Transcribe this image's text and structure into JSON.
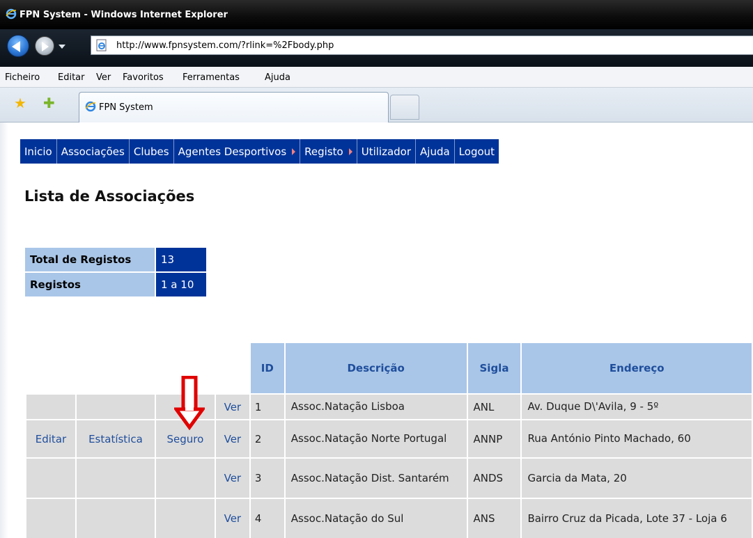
{
  "window": {
    "title": "FPN System - Windows Internet Explorer"
  },
  "address": {
    "url": "http://www.fpnsystem.com/?rlink=%2Fbody.php"
  },
  "menu": [
    "Ficheiro",
    "Editar",
    "Ver",
    "Favoritos",
    "Ferramentas",
    "Ajuda"
  ],
  "tab": {
    "label": "FPN System"
  },
  "nav": {
    "inicio": "Inicio",
    "associacoes": "Associações",
    "clubes": "Clubes",
    "agentes": "Agentes Desportivos",
    "registo": "Registo",
    "utilizador": "Utilizador",
    "ajuda": "Ajuda",
    "logout": "Logout"
  },
  "page": {
    "heading": "Lista de Associações"
  },
  "summary": {
    "total_label": "Total de Registos",
    "total_value": "13",
    "range_label": "Registos",
    "range_value": "1 a 10"
  },
  "table": {
    "headers": {
      "id": "ID",
      "descricao": "Descrição",
      "sigla": "Sigla",
      "endereco": "Endereço"
    },
    "rows": [
      {
        "editar": "",
        "estatistica": "",
        "seguro": "",
        "ver": "Ver",
        "id": "1",
        "descricao": "Assoc.Natação Lisboa",
        "sigla": "ANL",
        "endereco": "Av. Duque D\\'Avila, 9 - 5º"
      },
      {
        "editar": "Editar",
        "estatistica": "Estatística",
        "seguro": "Seguro",
        "ver": "Ver",
        "id": "2",
        "descricao": "Assoc.Natação Norte Portugal",
        "sigla": "ANNP",
        "endereco": "Rua António Pinto Machado, 60"
      },
      {
        "editar": "",
        "estatistica": "",
        "seguro": "",
        "ver": "Ver",
        "id": "3",
        "descricao": "Assoc.Natação Dist. Santarém",
        "sigla": "ANDS",
        "endereco": "Garcia da Mata, 20"
      },
      {
        "editar": "",
        "estatistica": "",
        "seguro": "",
        "ver": "Ver",
        "id": "4",
        "descricao": "Assoc.Natação do Sul",
        "sigla": "ANS",
        "endereco": "Bairro Cruz da Picada, Lote 37 - Loja 6"
      }
    ]
  },
  "colors": {
    "nav_bg": "#003399",
    "header_bg": "#a9c6e8",
    "cell_bg": "#dcdcdc",
    "link": "#1f4e9c",
    "annotation_arrow": "#e00000"
  },
  "icons": [
    "ie-icon",
    "back-arrow-icon",
    "forward-arrow-icon",
    "page-icon",
    "favorites-star-icon",
    "add-favorite-icon",
    "annotation-down-arrow"
  ]
}
